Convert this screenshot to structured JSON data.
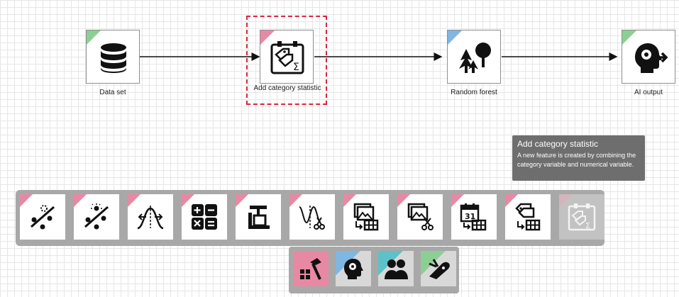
{
  "workflow": {
    "nodes": [
      {
        "label": "Data set",
        "tag_color": "#8ccf95",
        "icon": "database-icon"
      },
      {
        "label": "Add category statistic",
        "tag_color": "#e889a4",
        "icon": "category-statistic-icon",
        "selected": true
      },
      {
        "label": "Random forest",
        "tag_color": "#7fb6e2",
        "icon": "random-forest-icon"
      },
      {
        "label": "AI output",
        "tag_color": "#8ccf95",
        "icon": "ai-output-icon"
      }
    ]
  },
  "tooltip": {
    "title": "Add category statistic",
    "description": "A new feature is created by combining the category variable and numerical variable."
  },
  "palette": {
    "tag_color": "#e889a4",
    "tools": [
      {
        "icon": "missing-value-ratio-icon"
      },
      {
        "icon": "outlier-ratio-icon"
      },
      {
        "icon": "normal-distribution-icon"
      },
      {
        "icon": "calculator-icon"
      },
      {
        "icon": "clamp-icon"
      },
      {
        "icon": "distribution-cut-icon"
      },
      {
        "icon": "image-to-table-icon"
      },
      {
        "icon": "image-cut-icon"
      },
      {
        "icon": "date-to-table-icon"
      },
      {
        "icon": "tag-to-table-icon"
      },
      {
        "icon": "category-statistic-icon",
        "disabled": true
      }
    ]
  },
  "categories": [
    {
      "icon": "build-tools-icon",
      "tag_color": "#e889a4",
      "active": true
    },
    {
      "icon": "ai-head-gear-icon",
      "tag_color": "#7fb6e2"
    },
    {
      "icon": "users-icon",
      "tag_color": "#5cc1c9"
    },
    {
      "icon": "swiss-knife-icon",
      "tag_color": "#8ccf95"
    }
  ]
}
